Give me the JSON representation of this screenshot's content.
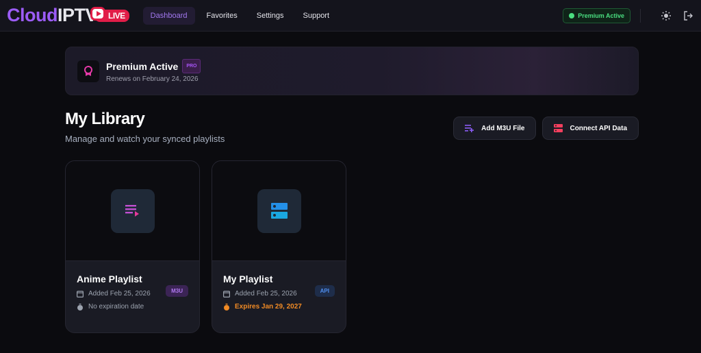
{
  "nav": {
    "logo": {
      "part1": "Cloud",
      "part2": "IPTV",
      "badge": "LIVE"
    },
    "items": [
      {
        "label": "Dashboard",
        "active": true
      },
      {
        "label": "Favorites"
      },
      {
        "label": "Settings"
      },
      {
        "label": "Support"
      }
    ],
    "status": "Premium Active",
    "icons": [
      "sun-icon",
      "logout-icon"
    ]
  },
  "banner": {
    "title": "Premium Active",
    "badge": "PRO",
    "subtitle": "Renews on February 24, 2026"
  },
  "library": {
    "title": "My Library",
    "subtitle": "Manage and watch your synced playlists",
    "actions": [
      {
        "label": "Add M3U File",
        "icon": "playlist-add-icon"
      },
      {
        "label": "Connect API Data",
        "icon": "server-icon"
      }
    ]
  },
  "cards": [
    {
      "title": "Anime Playlist",
      "tag": "M3U",
      "added": "Added Feb 25, 2026",
      "expiry": "No expiration date",
      "icon": "playlist-play-icon"
    },
    {
      "title": "My Playlist",
      "tag": "API",
      "added": "Added Feb 25, 2026",
      "expiry": "Expires Jan 29, 2027",
      "icon": "server-icon"
    }
  ],
  "colors": {
    "accent": "#9b5cf6",
    "live": "#e11d48",
    "success": "#4ade80",
    "warning": "#f08a24",
    "api": "#3b82f6"
  }
}
